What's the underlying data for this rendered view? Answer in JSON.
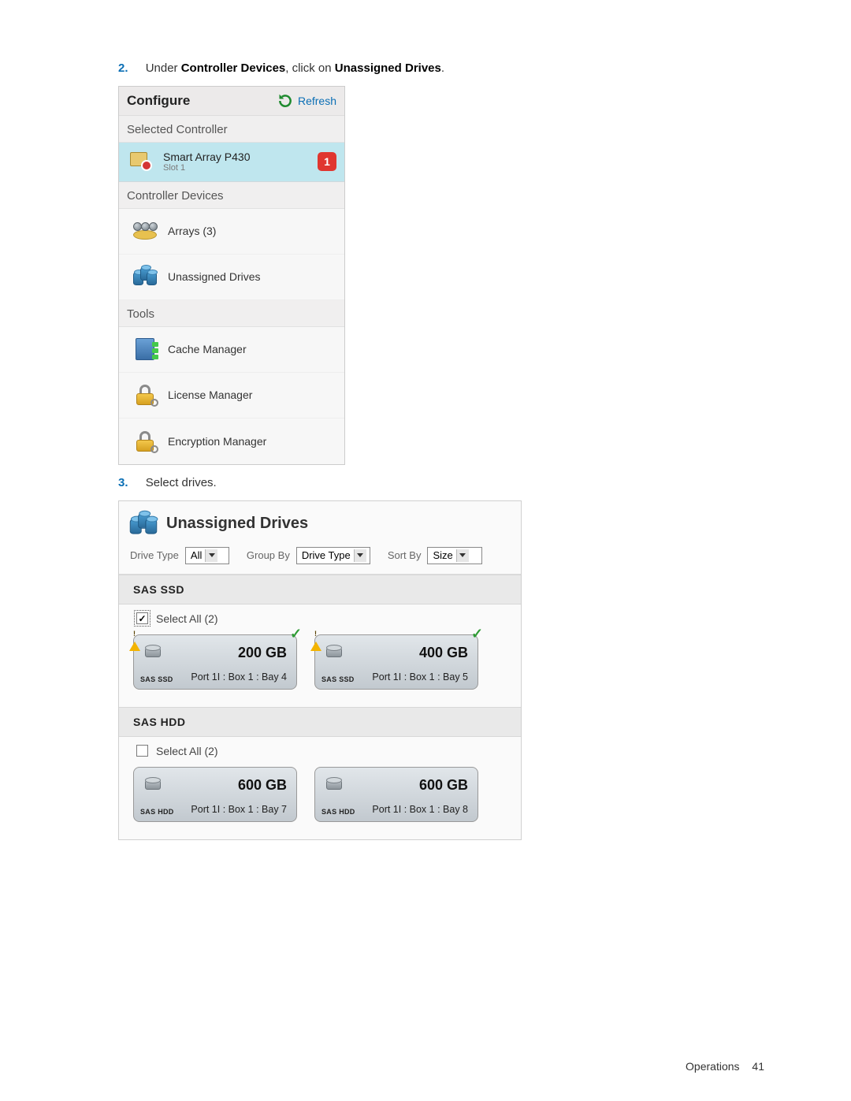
{
  "steps": {
    "two": {
      "num": "2.",
      "pre": "Under ",
      "b1": "Controller Devices",
      "mid": ", click on ",
      "b2": "Unassigned Drives",
      "post": "."
    },
    "three": {
      "num": "3.",
      "text": "Select drives."
    }
  },
  "configure": {
    "title": "Configure",
    "refresh": "Refresh",
    "section_selected": "Selected Controller",
    "controller": {
      "name": "Smart Array P430",
      "slot": "Slot 1",
      "alert": "1"
    },
    "section_devices": "Controller Devices",
    "arrays": "Arrays (3)",
    "unassigned": "Unassigned Drives",
    "section_tools": "Tools",
    "cache": "Cache Manager",
    "license": "License Manager",
    "encryption": "Encryption Manager"
  },
  "drivesPanel": {
    "title": "Unassigned Drives",
    "filter": {
      "driveTypeLabel": "Drive Type",
      "driveTypeValue": "All",
      "groupByLabel": "Group By",
      "groupByValue": "Drive Type",
      "sortByLabel": "Sort By",
      "sortByValue": "Size"
    },
    "groups": {
      "ssd": {
        "header": "SAS SSD",
        "selectAll": "Select All (2)",
        "drives": [
          {
            "type": "SAS SSD",
            "size": "200 GB",
            "loc": "Port 1I : Box 1 : Bay 4",
            "warn": true,
            "check": true
          },
          {
            "type": "SAS SSD",
            "size": "400 GB",
            "loc": "Port 1I : Box 1 : Bay 5",
            "warn": true,
            "check": true
          }
        ]
      },
      "hdd": {
        "header": "SAS HDD",
        "selectAll": "Select All (2)",
        "drives": [
          {
            "type": "SAS HDD",
            "size": "600 GB",
            "loc": "Port 1I : Box 1 : Bay 7",
            "warn": false,
            "check": false
          },
          {
            "type": "SAS HDD",
            "size": "600 GB",
            "loc": "Port 1I : Box 1 : Bay 8",
            "warn": false,
            "check": false
          }
        ]
      }
    }
  },
  "footer": {
    "section": "Operations",
    "page": "41"
  }
}
